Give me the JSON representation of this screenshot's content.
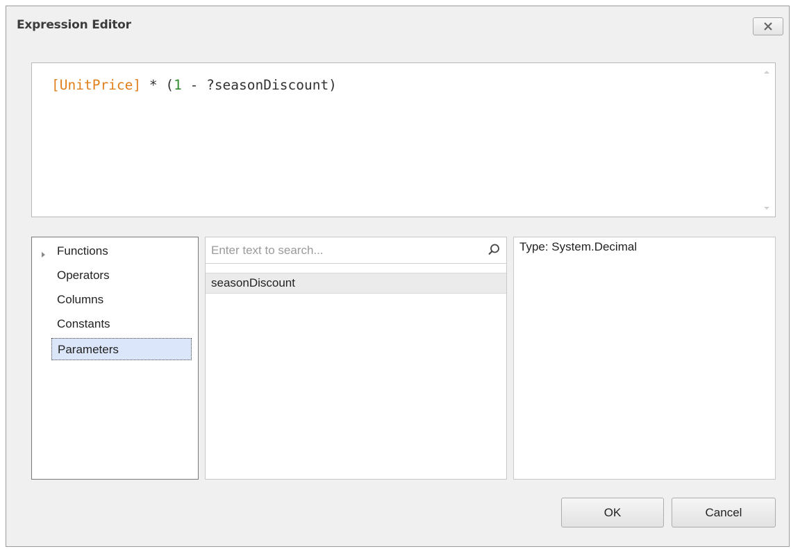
{
  "window": {
    "title": "Expression Editor",
    "close_icon": "close-x-icon"
  },
  "editor": {
    "expression_tokens": [
      {
        "text": "[UnitPrice]",
        "kind": "column",
        "color": "#e07f1a"
      },
      {
        "text": " * (",
        "kind": "operator",
        "color": "#333333"
      },
      {
        "text": "1",
        "kind": "number",
        "color": "#2d8a2d"
      },
      {
        "text": " - ?seasonDiscount)",
        "kind": "parameter",
        "color": "#333333"
      }
    ]
  },
  "categories": {
    "items": [
      {
        "label": "Functions",
        "expandable": true,
        "selected": false
      },
      {
        "label": "Operators",
        "expandable": false,
        "selected": false
      },
      {
        "label": "Columns",
        "expandable": false,
        "selected": false
      },
      {
        "label": "Constants",
        "expandable": false,
        "selected": false
      },
      {
        "label": "Parameters",
        "expandable": false,
        "selected": true
      }
    ]
  },
  "list": {
    "search_placeholder": "Enter text to search...",
    "search_value": "",
    "items": [
      {
        "label": "seasonDiscount",
        "selected": true
      }
    ]
  },
  "info": {
    "text": "Type: System.Decimal"
  },
  "buttons": {
    "ok_label": "OK",
    "cancel_label": "Cancel"
  }
}
